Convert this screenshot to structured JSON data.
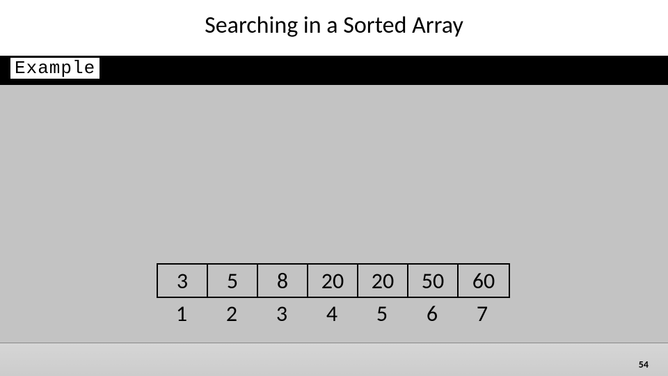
{
  "title": "Searching in a Sorted Array",
  "example_label": "Example",
  "array": {
    "values": [
      "3",
      "5",
      "8",
      "20",
      "20",
      "50",
      "60"
    ],
    "indices": [
      "1",
      "2",
      "3",
      "4",
      "5",
      "6",
      "7"
    ]
  },
  "page_number": "54"
}
